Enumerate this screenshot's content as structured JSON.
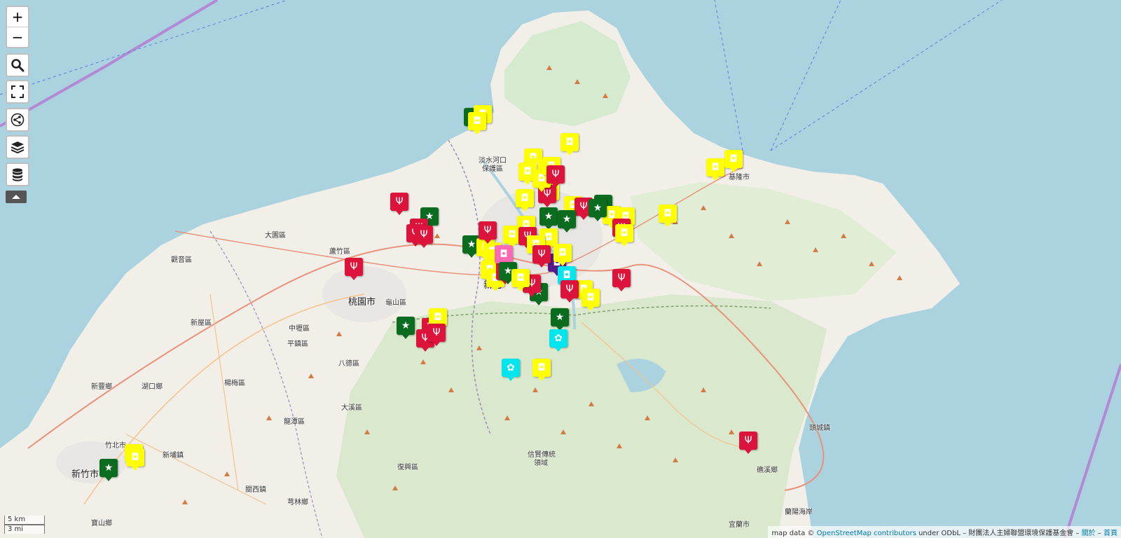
{
  "controls": {
    "zoom_in": "+",
    "zoom_out": "−",
    "search_icon": "search-icon",
    "fullscreen_icon": "fullscreen-icon",
    "share_icon": "share-icon",
    "layers_icon": "layers-icon",
    "data_icon": "database-icon",
    "collapse_icon": "triangle-up-icon"
  },
  "colors": {
    "water": "#aad3df",
    "land": "#f2efe9",
    "forest": "#cde8c8",
    "restaurant": "#dc143c",
    "shop": "#ffff00",
    "park": "#0b6b1e",
    "cyan": "#00e5ee",
    "pink": "#ff69b4",
    "purple": "#5a1a8c"
  },
  "places": [
    {
      "name": "淡水河口",
      "big": false
    },
    {
      "name": "保護區",
      "big": false
    },
    {
      "name": "大園區",
      "big": false
    },
    {
      "name": "蘆竹區",
      "big": false
    },
    {
      "name": "觀音區",
      "big": false
    },
    {
      "name": "桃園市",
      "big": true
    },
    {
      "name": "龜山區",
      "big": false
    },
    {
      "name": "中壢區",
      "big": false
    },
    {
      "name": "平鎮區",
      "big": false
    },
    {
      "name": "八德區",
      "big": false
    },
    {
      "name": "新屋區",
      "big": false
    },
    {
      "name": "楊梅區",
      "big": false
    },
    {
      "name": "湖口鄉",
      "big": false
    },
    {
      "name": "新豐鄉",
      "big": false
    },
    {
      "name": "大溪區",
      "big": false
    },
    {
      "name": "龍潭區",
      "big": false
    },
    {
      "name": "竹北市",
      "big": false
    },
    {
      "name": "新埔鎮",
      "big": false
    },
    {
      "name": "新竹市",
      "big": true
    },
    {
      "name": "復興區",
      "big": false
    },
    {
      "name": "關西鎮",
      "big": false
    },
    {
      "name": "芎林鄉",
      "big": false
    },
    {
      "name": "寶山鄉",
      "big": false
    },
    {
      "name": "頭城鎮",
      "big": false
    },
    {
      "name": "礁溪鄉",
      "big": false
    },
    {
      "name": "宜蘭市",
      "big": false
    },
    {
      "name": "蘭陽海岸",
      "big": false
    },
    {
      "name": "新北",
      "big": true
    },
    {
      "name": "基隆市",
      "big": false
    },
    {
      "name": "信賢傳統",
      "big": false
    },
    {
      "name": "領域",
      "big": false
    }
  ],
  "markers": [
    {
      "type": "park",
      "icon": "star"
    },
    {
      "type": "shop",
      "icon": "bag"
    },
    {
      "type": "shop",
      "icon": "bag"
    },
    {
      "type": "shop",
      "icon": "bag"
    },
    {
      "type": "restaurant",
      "icon": "utensils"
    },
    {
      "type": "park",
      "icon": "star"
    },
    {
      "type": "restaurant",
      "icon": "utensils"
    },
    {
      "type": "restaurant",
      "icon": "utensils"
    },
    {
      "type": "restaurant",
      "icon": "utensils"
    },
    {
      "type": "park",
      "icon": "star"
    },
    {
      "type": "restaurant",
      "icon": "utensils"
    },
    {
      "type": "shop",
      "icon": "bag"
    },
    {
      "type": "shop",
      "icon": "bag"
    },
    {
      "type": "restaurant",
      "icon": "utensils"
    },
    {
      "type": "shop",
      "icon": "bag"
    },
    {
      "type": "shop",
      "icon": "bag"
    },
    {
      "type": "shop",
      "icon": "bag"
    },
    {
      "type": "restaurant",
      "icon": "utensils"
    },
    {
      "type": "shop",
      "icon": "bag"
    },
    {
      "type": "shop",
      "icon": "bag"
    },
    {
      "type": "park",
      "icon": "star"
    },
    {
      "type": "shop",
      "icon": "bag"
    },
    {
      "type": "park",
      "icon": "star"
    },
    {
      "type": "shop",
      "icon": "bag"
    },
    {
      "type": "shop",
      "icon": "bag"
    },
    {
      "type": "restaurant",
      "icon": "utensils"
    },
    {
      "type": "shop",
      "icon": "bag"
    },
    {
      "type": "restaurant",
      "icon": "utensils"
    },
    {
      "type": "park",
      "icon": "star"
    },
    {
      "type": "shop",
      "icon": "bag"
    },
    {
      "type": "restaurant",
      "icon": "utensils"
    },
    {
      "type": "shop",
      "icon": "bag"
    },
    {
      "type": "shop",
      "icon": "bag"
    },
    {
      "type": "restaurant",
      "icon": "utensils"
    },
    {
      "type": "pink",
      "icon": "bag"
    },
    {
      "type": "purple",
      "icon": "bag"
    },
    {
      "type": "cyan",
      "icon": "bag"
    },
    {
      "type": "park",
      "icon": "star"
    },
    {
      "type": "restaurant",
      "icon": "utensils"
    },
    {
      "type": "shop",
      "icon": "bag"
    },
    {
      "type": "shop",
      "icon": "bag"
    },
    {
      "type": "park",
      "icon": "star"
    },
    {
      "type": "restaurant",
      "icon": "utensils"
    },
    {
      "type": "shop",
      "icon": "bag"
    },
    {
      "type": "shop",
      "icon": "bag"
    },
    {
      "type": "restaurant",
      "icon": "utensils"
    },
    {
      "type": "shop",
      "icon": "bag"
    },
    {
      "type": "park",
      "icon": "star"
    },
    {
      "type": "shop",
      "icon": "bag"
    },
    {
      "type": "cyan",
      "icon": "flower"
    },
    {
      "type": "cyan",
      "icon": "flower"
    },
    {
      "type": "shop",
      "icon": "bag"
    },
    {
      "type": "park",
      "icon": "star"
    },
    {
      "type": "restaurant",
      "icon": "utensils"
    },
    {
      "type": "restaurant",
      "icon": "utensils"
    },
    {
      "type": "shop",
      "icon": "bag"
    },
    {
      "type": "restaurant",
      "icon": "utensils"
    },
    {
      "type": "shop",
      "icon": "bag"
    },
    {
      "type": "shop",
      "icon": "bag"
    },
    {
      "type": "shop",
      "icon": "bag"
    },
    {
      "type": "restaurant",
      "icon": "utensils"
    },
    {
      "type": "park",
      "icon": "star"
    },
    {
      "type": "shop",
      "icon": "bag"
    },
    {
      "type": "shop",
      "icon": "bag"
    },
    {
      "type": "shop",
      "icon": "bag"
    },
    {
      "type": "shop",
      "icon": "bag"
    },
    {
      "type": "restaurant",
      "icon": "utensils"
    },
    {
      "type": "restaurant",
      "icon": "utensils"
    },
    {
      "type": "shop",
      "icon": "bag"
    },
    {
      "type": "park",
      "icon": "star"
    },
    {
      "type": "shop",
      "icon": "bag"
    },
    {
      "type": "restaurant",
      "icon": "utensils"
    }
  ],
  "scale": {
    "metric": "5 km",
    "imperial": "3 mi"
  },
  "attribution": {
    "prefix": "map data © ",
    "link": "OpenStreetMap contributors",
    "middle": " under ODbL – 財團法人主婦聯盟環境保護基金會 – ",
    "about": "關於",
    "sep": " – ",
    "home": "首頁"
  }
}
